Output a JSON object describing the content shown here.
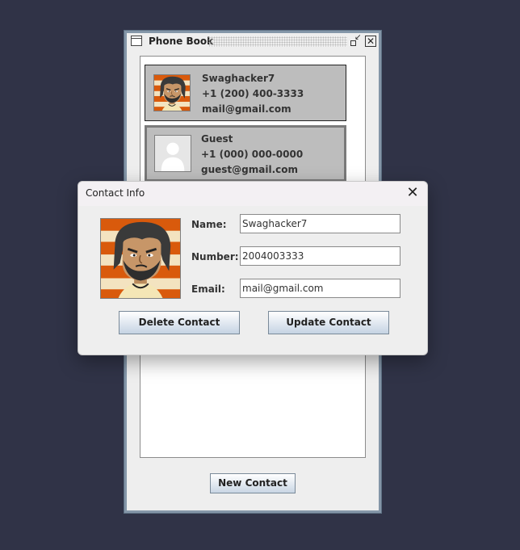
{
  "phonebook": {
    "title": "Phone Book",
    "contacts": [
      {
        "name": "Swaghacker7",
        "number": "+1 (200) 400-3333",
        "email": "mail@gmail.com",
        "avatar": "cartoon-person-portrait"
      },
      {
        "name": "Guest",
        "number": "+1 (000) 000-0000",
        "email": "guest@gmail.com",
        "avatar": "default-user-silhouette"
      }
    ],
    "new_contact_label": "New Contact"
  },
  "dialog": {
    "title": "Contact Info",
    "close_glyph": "✕",
    "fields": {
      "name_label": "Name:",
      "name_value": "Swaghacker7",
      "number_label": "Number:",
      "number_value": "2004003333",
      "email_label": "Email:",
      "email_value": "mail@gmail.com"
    },
    "delete_label": "Delete Contact",
    "update_label": "Update Contact"
  },
  "colors": {
    "desktop": "#303347",
    "window_border": "#5e7184",
    "card_bg": "#bdbdbd",
    "avatar_orange": "#d95a0c"
  }
}
